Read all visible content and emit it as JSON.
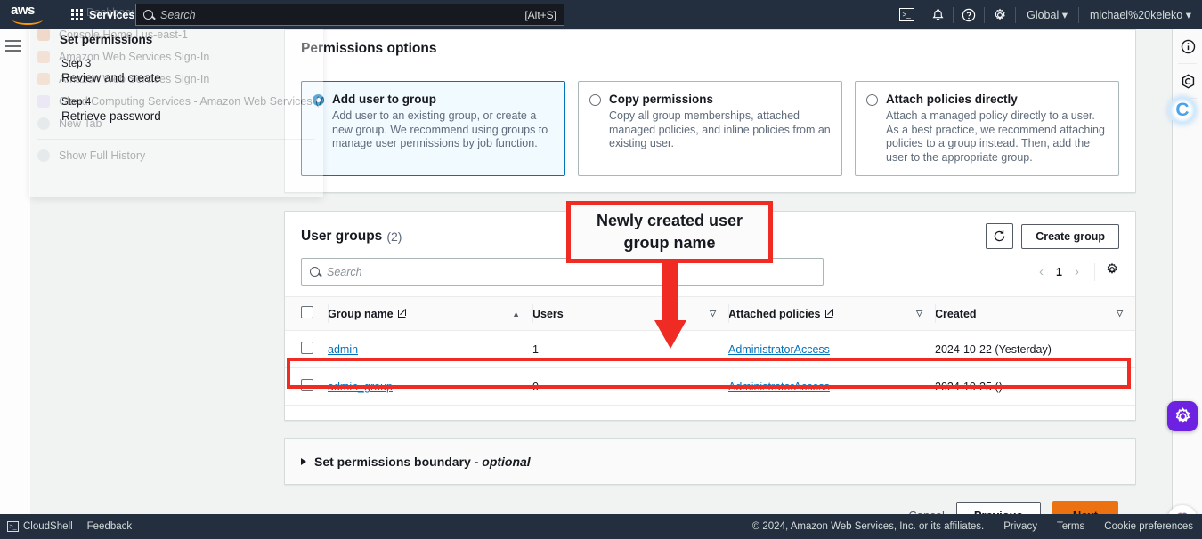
{
  "topnav": {
    "logo_alt": "aws",
    "ghost_title": "Dashboard | IAM | Global",
    "services_label": "Services",
    "search_placeholder": "Search",
    "search_value": "",
    "search_shortcut": "[Alt+S]",
    "region_label": "Global",
    "account_label": "michael%20keleko"
  },
  "history_popup": {
    "items": [
      "Console Home | us-east-1",
      "Amazon Web Services Sign-In",
      "Amazon Web Services Sign-In",
      "Cloud Computing Services - Amazon Web Services (AWS)",
      "New Tab"
    ],
    "show_full_history": "Show Full History"
  },
  "wizard": {
    "current_step_title": "Set permissions",
    "step3_num": "Step 3",
    "step3_label": "Review and create",
    "step4_num": "Step 4",
    "step4_label": "Retrieve password"
  },
  "permissions": {
    "section_title": "Permissions options",
    "options": [
      {
        "label": "Add user to group",
        "desc": "Add user to an existing group, or create a new group. We recommend using groups to manage user permissions by job function.",
        "selected": true
      },
      {
        "label": "Copy permissions",
        "desc": "Copy all group memberships, attached managed policies, and inline policies from an existing user.",
        "selected": false
      },
      {
        "label": "Attach policies directly",
        "desc": "Attach a managed policy directly to a user. As a best practice, we recommend attaching policies to a group instead. Then, add the user to the appropriate group.",
        "selected": false
      }
    ]
  },
  "user_groups": {
    "title": "User groups",
    "count": "(2)",
    "create_group_label": "Create group",
    "search_placeholder": "Search",
    "search_value": "",
    "page_number": "1",
    "columns": [
      "Group name",
      "Users",
      "Attached policies",
      "Created"
    ],
    "rows": [
      {
        "selected": false,
        "group_name": "admin",
        "users": "1",
        "attached_policies": "AdministratorAccess",
        "created": "2024-10-22 (Yesterday)",
        "highlighted": false
      },
      {
        "selected": false,
        "group_name": "admin_group",
        "users": "0",
        "attached_policies": "AdministratorAccess",
        "created": "2024-10-25 ()",
        "highlighted": true
      }
    ]
  },
  "permissions_boundary": {
    "label": "Set permissions boundary - ",
    "optional": "optional"
  },
  "form_actions": {
    "cancel": "Cancel",
    "previous": "Previous",
    "next": "Next"
  },
  "annotation": {
    "callout_line1": "Newly created user",
    "callout_line2": "group name",
    "color": "#ef2b23"
  },
  "footer": {
    "cloudshell": "CloudShell",
    "feedback": "Feedback",
    "copyright": "© 2024, Amazon Web Services, Inc. or its affiliates.",
    "privacy": "Privacy",
    "terms": "Terms",
    "cookie_preferences": "Cookie preferences"
  },
  "colors": {
    "nav_bg": "#232f3e",
    "accent_orange": "#ec7211",
    "link_blue": "#0073bb",
    "selected_tile_bg": "#f1faff",
    "annotation_red": "#ef2b23"
  }
}
